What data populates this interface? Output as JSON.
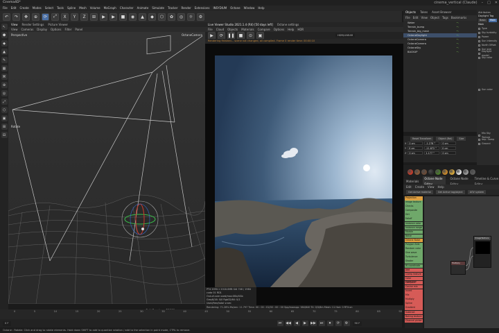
{
  "app": {
    "title": "Cinema4D*",
    "window_title": "cinema_vertical (Claude)",
    "close": "✕",
    "minimize": "–",
    "maximize": "□"
  },
  "menubar": [
    "File",
    "Edit",
    "Create",
    "Modes",
    "Select",
    "Tools",
    "Spline",
    "Mesh",
    "Volume",
    "MoGraph",
    "Character",
    "Animate",
    "Simulate",
    "Tracker",
    "Render",
    "Extensions",
    "INSYDIUM",
    "Octane",
    "Window",
    "Help"
  ],
  "toolbar": {
    "icons": [
      "↶",
      "↷",
      "✥",
      "⊕",
      "⟳",
      "⤢",
      "X",
      "Y",
      "Z",
      "⊞",
      "▶",
      "▶",
      "■",
      "◉",
      "▲",
      "◆",
      "⬡",
      "✿",
      "◎",
      "☼",
      "⚙"
    ]
  },
  "left_tools": [
    "↖",
    "⬢",
    "◆",
    "▲",
    "✎",
    "▦",
    "⌘",
    "⊕",
    "◎",
    "⤢",
    "⬡",
    "▣",
    "⊞",
    "⊟"
  ],
  "viewport": {
    "tabs": [
      "View",
      "Render Settings",
      "Picture Viewer"
    ],
    "menu": [
      "View",
      "Cameras",
      "Display",
      "Options",
      "Filter",
      "Panel"
    ],
    "label": "Perspective",
    "camera": "OctaneCamera",
    "hud_label": "Rotate",
    "grid_spacing": "Grid Spacing : 50000 cm"
  },
  "live_viewer": {
    "tabs": [
      "Live Viewer Studio 2021.1.4 (R4) [50 days left]",
      "Octane settings"
    ],
    "menu": [
      "File",
      "Cloud",
      "Objects",
      "Materials",
      "Compare",
      "Options",
      "Help",
      "HDR"
    ],
    "mode": "HDR/LINEAR",
    "stats": [
      "PT4 2090.1 2018.0MB  GAI  746 / 1984 cuda 01 RD1",
      "Out-of-core used/max:0Kb/4Gb",
      "Grey8/16: 0/0   Rgb32/64: 0/1",
      "Used/free/total vram: 2.648Gb/6.823Gb/8Gb"
    ],
    "status": "Rendering: 71.28%   Ms/sec: 11.797   Time: 00 : 00 : 01/00 : 00 : 00   Spp/maxspp: 384/640   Tri: 0/3/8m   Mesh: 11   Hair: 0   RTX:on",
    "warning_line": "Rendering finished... scene not changed, all compiled. Frame 0 render time: 00:00:10"
  },
  "timeline": {
    "ticks": [
      "0",
      "5",
      "10",
      "15",
      "20",
      "25",
      "30",
      "35",
      "40",
      "45",
      "50",
      "55",
      "60",
      "65",
      "70",
      "75",
      "80",
      "85",
      "90"
    ],
    "current_frame": "0 F",
    "end_frame": "90 F"
  },
  "transport": [
    "⏮",
    "◀◀",
    "◀",
    "▶",
    "▶▶",
    "⏭",
    "⏺",
    "⟳",
    "⚙"
  ],
  "statusbar": "Octane : Rotate: Click and drag to rotate elements. Hold down SHIFT to add to quantize rotation / add to the selection in point mode, CTRL to remove.",
  "objects": {
    "tabs": [
      "Objects",
      "Takes",
      "Asset Browser"
    ],
    "menu": [
      "File",
      "Edit",
      "View",
      "Object",
      "Tags",
      "Bookmarks"
    ],
    "items": [
      "Water",
      "Terrain_bump",
      "Terrain_big_mesh",
      "OctaneDaylight",
      "OctaneCamera",
      "OctaneCamera",
      "OctaneSky",
      "BACKUP"
    ],
    "visibility": "•:"
  },
  "attributes": {
    "title": "Attributes",
    "object": "Daylight Tag",
    "tabs": [
      "Basic",
      "Main"
    ],
    "section": "Main",
    "rows": [
      "Type",
      "Sky turbidity",
      "Power",
      "Sun intensity",
      "North Offset",
      "Sun size",
      "Daylight model",
      "Sky color",
      "Sun color",
      "Mix Sky Texture",
      "Imp. Samp",
      "Ground"
    ]
  },
  "coordinates": {
    "menu": [
      "Reset Transform",
      "Object (Rel)",
      "Size"
    ],
    "rows": [
      {
        "axis": "X",
        "pos": "0 cm",
        "rot": "-1.278 °",
        "size": "0 cm"
      },
      {
        "axis": "Y",
        "pos": "0 cm",
        "rot": "-11.872 °",
        "size": "0 cm"
      },
      {
        "axis": "Z",
        "pos": "0 cm",
        "rot": "1.177 °",
        "size": "0 cm"
      }
    ]
  },
  "materials": {
    "swatches": [
      "#c43c2a",
      "#8a5a3a",
      "#6a4a36",
      "#2c2c2c",
      "#4a7a2a",
      "#c8882a",
      "#d8a83a",
      "#e8e8e8",
      "#9a9a9a",
      "#5a5a5a"
    ]
  },
  "node_editor": {
    "tabs": [
      "Materials",
      "Octane Node Editor",
      "Octane Node Editor",
      "Timeline & Curve Editor"
    ],
    "menu": [
      "Edit",
      "Create",
      "View",
      "Help"
    ],
    "buttons": [
      "Get Active material",
      "Get Active tag/object",
      "AOV system"
    ],
    "node_list": [
      {
        "label": "Projection",
        "color": "#e0a040"
      },
      {
        "label": "Image texture",
        "color": "#6fa86a"
      },
      {
        "label": "Checks",
        "color": "#6fa86a"
      },
      {
        "label": "Composite",
        "color": "#6fa86a"
      },
      {
        "label": "Dirt",
        "color": "#6fa86a"
      },
      {
        "label": "Falloff",
        "color": "#6fa86a"
      },
      {
        "label": "Instance color",
        "color": "#6fa86a"
      },
      {
        "label": "Instance range",
        "color": "#6fa86a"
      },
      {
        "label": "Marble",
        "color": "#6fa86a"
      },
      {
        "label": "Noise",
        "color": "#6fa86a"
      },
      {
        "label": "Octane Noise",
        "color": "#e0a040"
      },
      {
        "label": "Polygon Side",
        "color": "#6fa86a"
      },
      {
        "label": "Random color",
        "color": "#6fa86a"
      },
      {
        "label": "Sine wave",
        "color": "#6fa86a"
      },
      {
        "label": "Turbulence",
        "color": "#6fa86a"
      },
      {
        "label": "Shader",
        "color": "#6fa86a"
      },
      {
        "label": "W coordinate",
        "color": "#6fa86a"
      },
      {
        "label": "Add",
        "color": "#d65b57"
      },
      {
        "label": "Clamp texture",
        "color": "#d65b57"
      },
      {
        "label": "Color correction",
        "color": "#d65b57"
      },
      {
        "label": "Compare",
        "color": "#d65b57"
      },
      {
        "label": "Cosine mix",
        "color": "#d65b57"
      },
      {
        "label": "Invert",
        "color": "#d65b57"
      },
      {
        "label": "Mix",
        "color": "#d65b57"
      },
      {
        "label": "Multiply",
        "color": "#d65b57"
      },
      {
        "label": "Spline",
        "color": "#d65b57"
      },
      {
        "label": "Gradient",
        "color": "#d65b57"
      },
      {
        "label": "Subtract",
        "color": "#d65b57"
      },
      {
        "label": "Baking texture",
        "color": "#d65b57"
      },
      {
        "label": "Channel picker",
        "color": "#d65b57"
      }
    ],
    "node_title": "ImageTexture",
    "node2_title": "Multiply"
  }
}
